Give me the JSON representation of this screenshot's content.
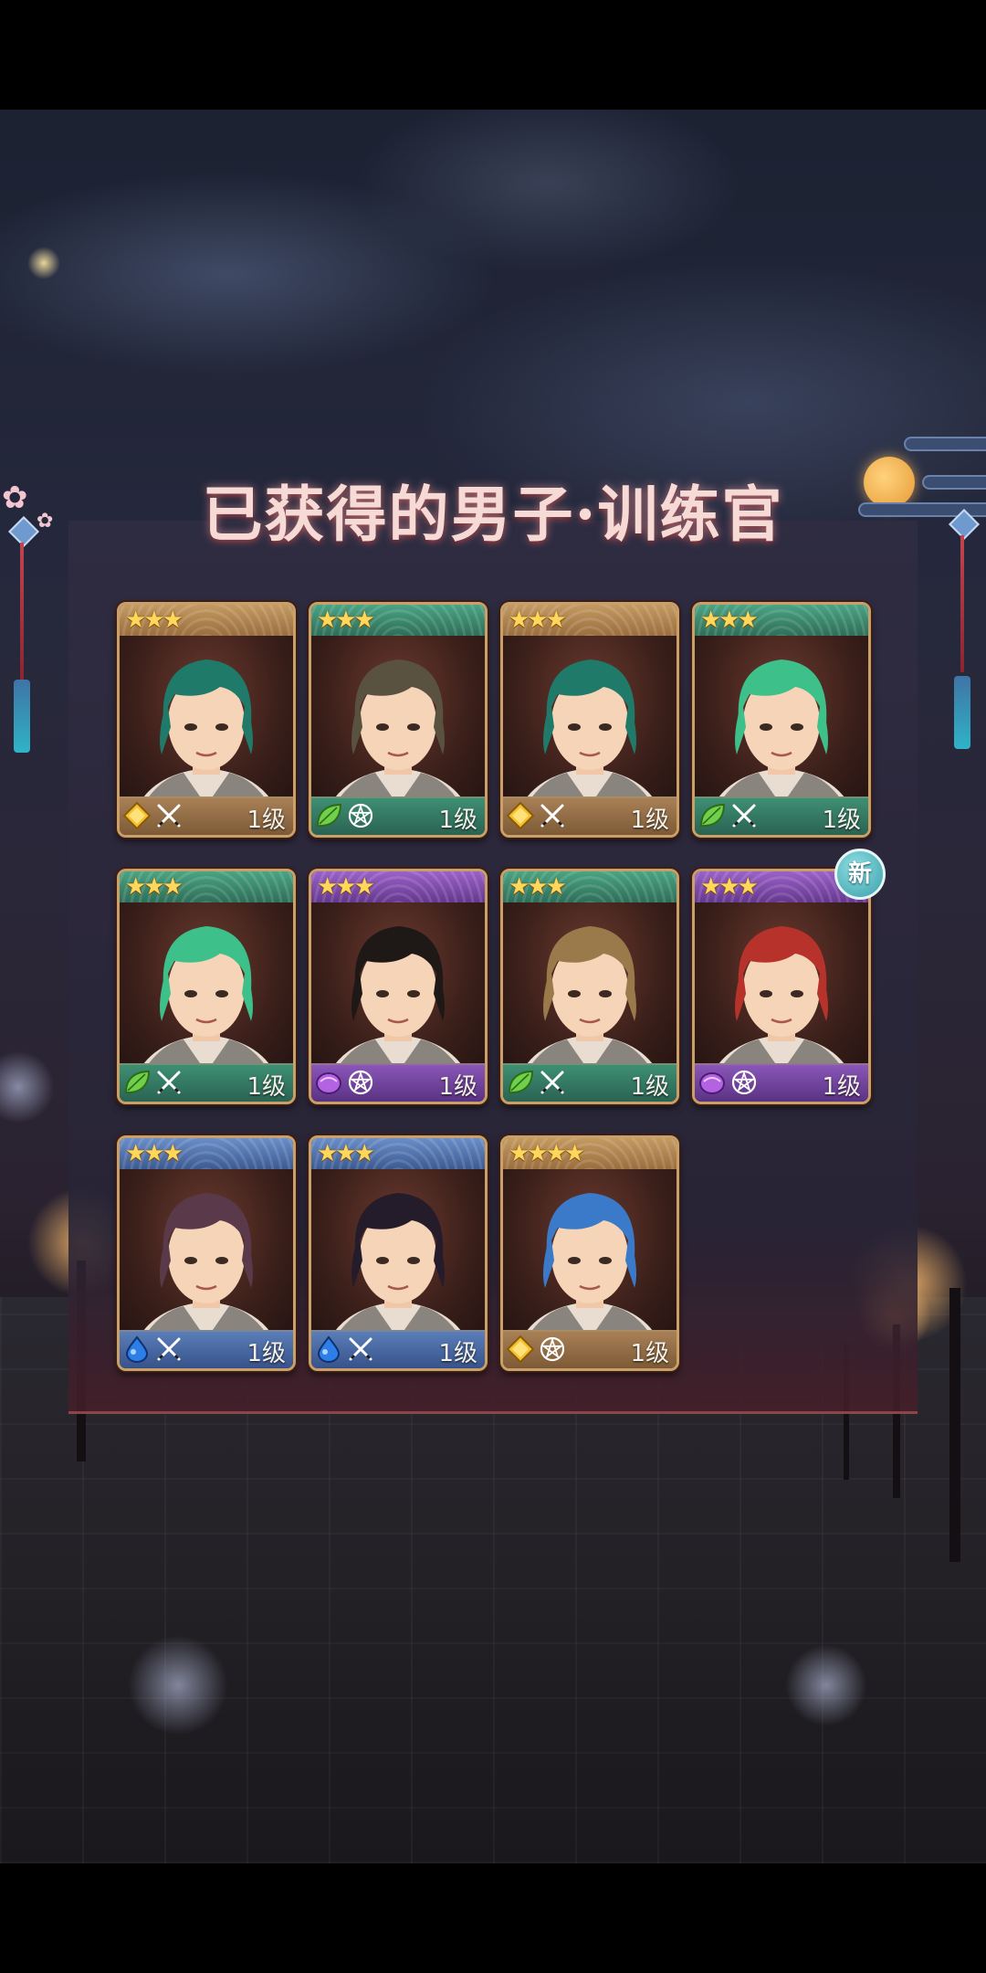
{
  "title": "已获得的男子·训练官",
  "new_badge_label": "新",
  "colors": {
    "frame_gold": "#caa06a",
    "bar_gold": "#b48a52",
    "bar_green": "#3e8a6e",
    "bar_purple": "#7a4aa8",
    "bar_blue": "#4a6aa8",
    "title_pink": "#f6dad6"
  },
  "cards": [
    {
      "stars": "★★★",
      "theme": "gold",
      "element_icon": "diamond-gold-icon",
      "class_icon": "crossed-swords-icon",
      "level": "1级",
      "hair": "#1f7a6a",
      "is_new": false
    },
    {
      "stars": "★★★",
      "theme": "green",
      "element_icon": "leaf-icon",
      "class_icon": "pentagram-icon",
      "level": "1级",
      "hair": "#5a5240",
      "is_new": false
    },
    {
      "stars": "★★★",
      "theme": "gold",
      "element_icon": "diamond-gold-icon",
      "class_icon": "crossed-swords-icon",
      "level": "1级",
      "hair": "#1f7a6a",
      "is_new": false
    },
    {
      "stars": "★★★",
      "theme": "green",
      "element_icon": "leaf-icon",
      "class_icon": "crossed-swords-icon",
      "level": "1级",
      "hair": "#3ec08a",
      "is_new": false
    },
    {
      "stars": "★★★",
      "theme": "green",
      "element_icon": "leaf-icon",
      "class_icon": "crossed-swords-icon",
      "level": "1级",
      "hair": "#3ec08a",
      "is_new": false
    },
    {
      "stars": "★★★",
      "theme": "purple",
      "element_icon": "crystal-purple-icon",
      "class_icon": "pentagram-icon",
      "level": "1级",
      "hair": "#1e1816",
      "is_new": false
    },
    {
      "stars": "★★★",
      "theme": "green",
      "element_icon": "leaf-icon",
      "class_icon": "crossed-swords-icon",
      "level": "1级",
      "hair": "#9a7a4a",
      "is_new": false
    },
    {
      "stars": "★★★",
      "theme": "purple",
      "element_icon": "crystal-purple-icon",
      "class_icon": "pentagram-icon",
      "level": "1级",
      "hair": "#b8322c",
      "is_new": true
    },
    {
      "stars": "★★★",
      "theme": "blue",
      "element_icon": "water-drop-icon",
      "class_icon": "crossed-swords-icon",
      "level": "1级",
      "hair": "#5a3a4a",
      "is_new": false
    },
    {
      "stars": "★★★",
      "theme": "blue",
      "element_icon": "water-drop-icon",
      "class_icon": "crossed-swords-icon",
      "level": "1级",
      "hair": "#241c2a",
      "is_new": false
    },
    {
      "stars": "★★★★",
      "theme": "gold",
      "element_icon": "diamond-gold-icon",
      "class_icon": "pentagram-icon",
      "level": "1级",
      "hair": "#3a7ac8",
      "is_new": false
    }
  ]
}
